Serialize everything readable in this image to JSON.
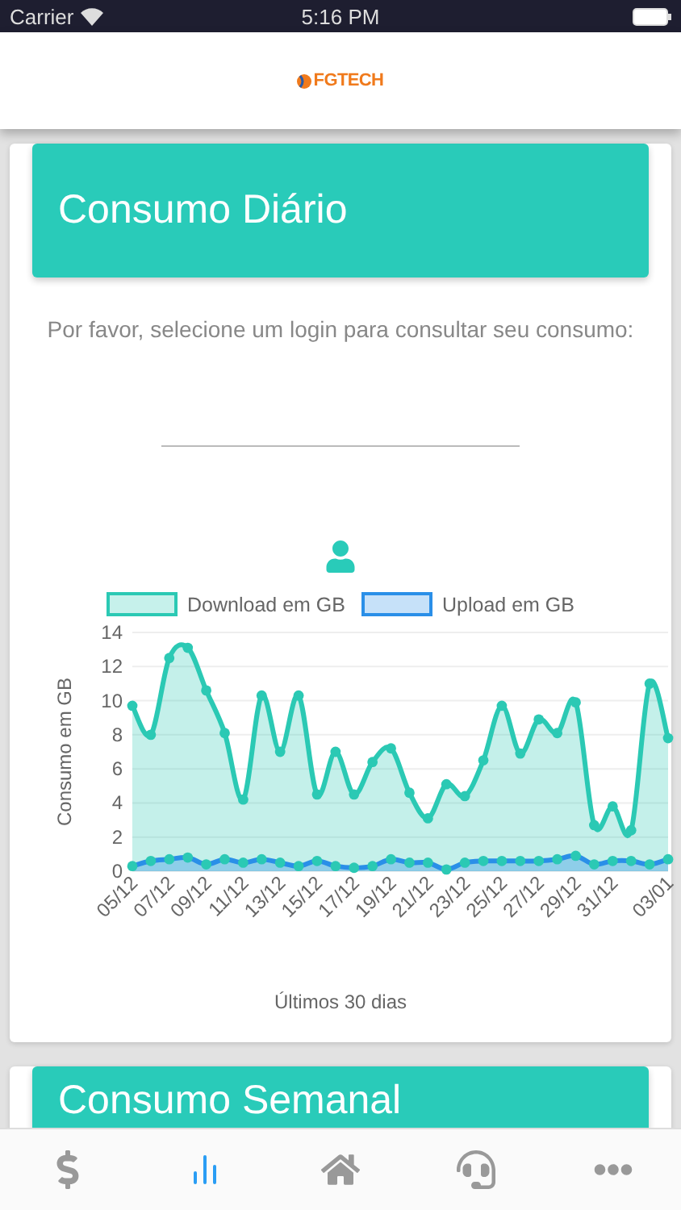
{
  "status_bar": {
    "carrier": "Carrier",
    "time": "5:16 PM"
  },
  "header": {
    "logo": "FGTECH"
  },
  "cards": [
    {
      "title": "Consumo Diário",
      "prompt": "Por favor, selecione um login para consultar seu consumo:",
      "chart_data": {
        "type": "area",
        "xlabel": "Últimos 30 dias",
        "ylabel": "Consumo em GB",
        "categories": [
          "05/12",
          null,
          "07/12",
          null,
          "09/12",
          null,
          "11/12",
          null,
          "13/12",
          null,
          "15/12",
          null,
          "17/12",
          null,
          "19/12",
          null,
          "21/12",
          null,
          "23/12",
          null,
          "25/12",
          null,
          "27/12",
          null,
          "29/12",
          null,
          "31/12",
          null,
          null,
          "03/01"
        ],
        "grid": true,
        "series": [
          {
            "name": "Download em GB",
            "color": "#2bc9b4",
            "values": [
              9.7,
              8.0,
              12.5,
              13.1,
              10.6,
              8.1,
              4.2,
              10.3,
              7.0,
              10.3,
              4.5,
              7.0,
              4.5,
              6.4,
              7.2,
              4.6,
              3.1,
              5.1,
              4.4,
              6.5,
              9.7,
              6.9,
              8.9,
              8.1,
              9.9,
              2.7,
              3.8,
              2.4,
              11.0,
              7.8
            ]
          },
          {
            "name": "Upload em GB",
            "color": "#2a8fe8",
            "values": [
              0.3,
              0.6,
              0.7,
              0.8,
              0.4,
              0.7,
              0.5,
              0.7,
              0.5,
              0.3,
              0.6,
              0.3,
              0.2,
              0.3,
              0.7,
              0.5,
              0.5,
              0.1,
              0.5,
              0.6,
              0.6,
              0.6,
              0.6,
              0.7,
              0.9,
              0.4,
              0.6,
              0.6,
              0.4,
              0.7
            ]
          }
        ],
        "ylim": [
          0,
          14
        ],
        "yticks": [
          0,
          2,
          4,
          6,
          8,
          10,
          12,
          14
        ]
      }
    },
    {
      "title": "Consumo Semanal"
    }
  ],
  "tab_bar": [
    {
      "kind": "dollar",
      "selected": false
    },
    {
      "kind": "chart",
      "selected": true
    },
    {
      "kind": "home",
      "selected": false
    },
    {
      "kind": "support",
      "selected": false
    },
    {
      "kind": "more",
      "selected": false
    }
  ]
}
